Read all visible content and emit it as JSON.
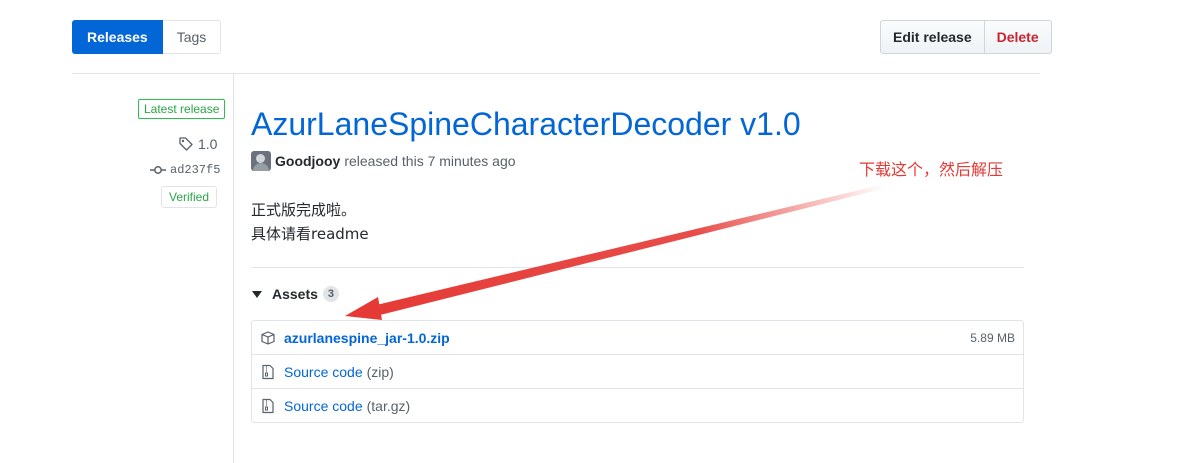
{
  "tabs": [
    {
      "label": "Releases",
      "selected": true
    },
    {
      "label": "Tags",
      "selected": false
    }
  ],
  "actions": {
    "edit_label": "Edit release",
    "delete_label": "Delete"
  },
  "release": {
    "badge": "Latest release",
    "tag": "1.0",
    "commit": "ad237f5",
    "verified": "Verified",
    "title": "AzurLaneSpineCharacterDecoder v1.0",
    "author": "Goodjooy",
    "released_text": "released this 7 minutes ago",
    "body_lines": [
      "正式版完成啦。",
      "具体请看readme"
    ]
  },
  "assets": {
    "header": "Assets",
    "count": "3",
    "items": [
      {
        "name": "azurlanespine_jar-1.0.zip",
        "size": "5.89 MB",
        "icon": "package-icon"
      },
      {
        "name": "Source code",
        "format": "(zip)",
        "icon": "file-zip-icon"
      },
      {
        "name": "Source code",
        "format": "(tar.gz)",
        "icon": "file-zip-icon"
      }
    ]
  },
  "annotation": {
    "text": "下载这个，然后解压",
    "color": "#e53935"
  },
  "colors": {
    "accent": "#0366d6",
    "danger": "#cb2431",
    "success": "#28a745"
  }
}
